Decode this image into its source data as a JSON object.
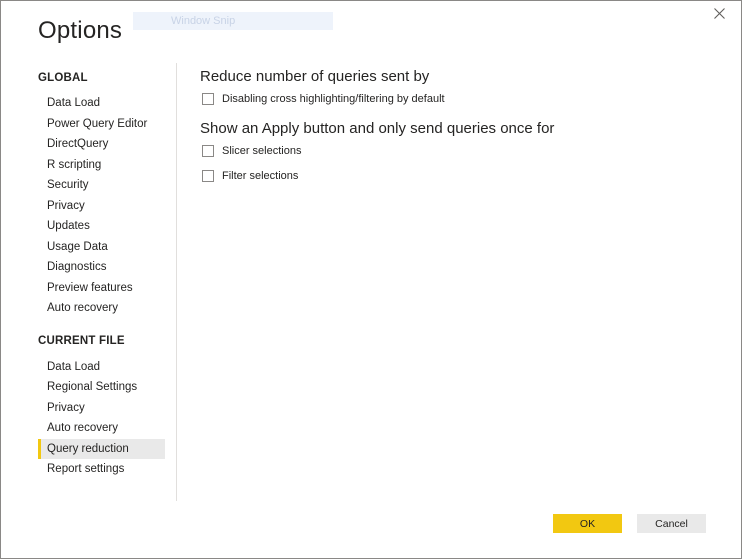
{
  "dialog": {
    "title": "Options",
    "snip_badge": "Window Snip",
    "close_icon": "close-icon"
  },
  "sidebar": {
    "global_header": "GLOBAL",
    "global_items": [
      {
        "label": "Data Load"
      },
      {
        "label": "Power Query Editor"
      },
      {
        "label": "DirectQuery"
      },
      {
        "label": "R scripting"
      },
      {
        "label": "Security"
      },
      {
        "label": "Privacy"
      },
      {
        "label": "Updates"
      },
      {
        "label": "Usage Data"
      },
      {
        "label": "Diagnostics"
      },
      {
        "label": "Preview features"
      },
      {
        "label": "Auto recovery"
      }
    ],
    "current_header": "CURRENT FILE",
    "current_items": [
      {
        "label": "Data Load"
      },
      {
        "label": "Regional Settings"
      },
      {
        "label": "Privacy"
      },
      {
        "label": "Auto recovery"
      },
      {
        "label": "Query reduction",
        "selected": true
      },
      {
        "label": "Report settings"
      }
    ]
  },
  "main": {
    "heading1": "Reduce number of queries sent by",
    "option1": {
      "label": "Disabling cross highlighting/filtering by default",
      "checked": false
    },
    "heading2": "Show an Apply button and only send queries once for",
    "option2": {
      "label": "Slicer selections",
      "checked": false
    },
    "option3": {
      "label": "Filter selections",
      "checked": false
    }
  },
  "footer": {
    "ok_label": "OK",
    "cancel_label": "Cancel"
  },
  "colors": {
    "accent": "#F2C811",
    "selected_bg": "#E9E9E9",
    "text": "#252423"
  }
}
